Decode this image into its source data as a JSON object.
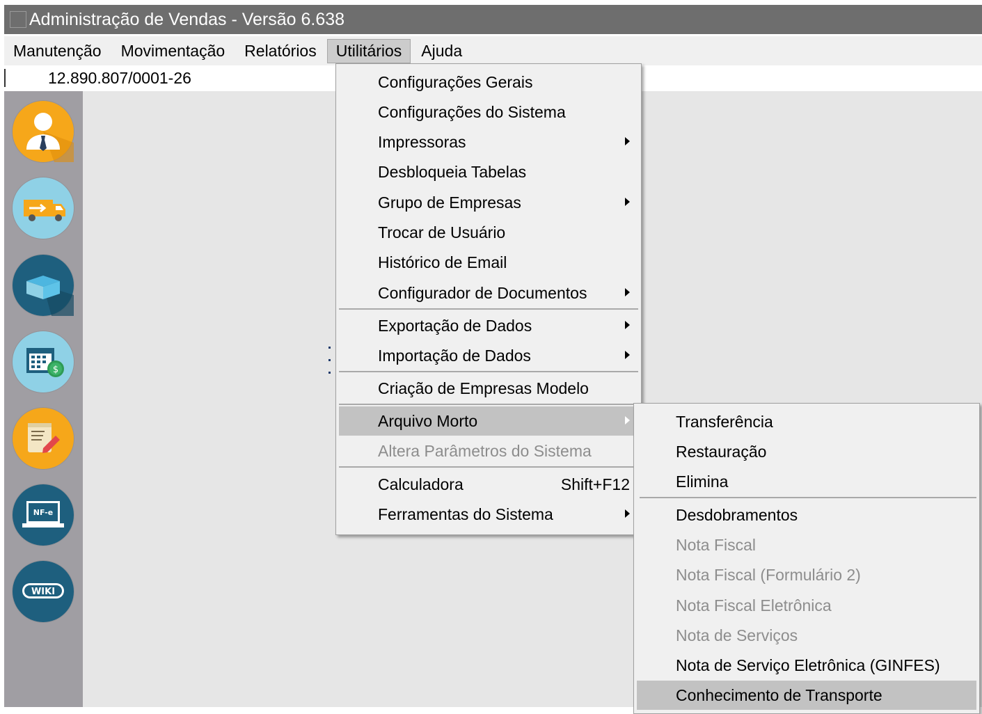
{
  "window": {
    "title": "Administração de Vendas - Versão 6.638"
  },
  "menubar": {
    "items": [
      {
        "label": "Manutenção"
      },
      {
        "label": "Movimentação"
      },
      {
        "label": "Relatórios"
      },
      {
        "label": "Utilitários",
        "active": true
      },
      {
        "label": "Ajuda"
      }
    ]
  },
  "company": {
    "cnpj": "12.890.807/0001-26"
  },
  "sidebar": {
    "buttons": [
      {
        "icon": "user-icon",
        "color": "#f6a71a"
      },
      {
        "icon": "delivery-truck-icon",
        "color": "#8fd1e6"
      },
      {
        "icon": "box-icon",
        "color": "#1e5f7e"
      },
      {
        "icon": "calendar-money-icon",
        "color": "#8fd1e6"
      },
      {
        "icon": "document-edit-icon",
        "color": "#f6a71a"
      },
      {
        "icon": "nfe-laptop-icon",
        "color": "#1e5f7e"
      },
      {
        "icon": "wiki-icon",
        "color": "#1e5f7e"
      }
    ],
    "nfe_label": "NF-e",
    "wiki_label": "WIKI"
  },
  "utilitarios_menu": {
    "items": [
      {
        "label": "Configurações Gerais"
      },
      {
        "label": "Configurações do Sistema"
      },
      {
        "label": "Impressoras",
        "submenu": true
      },
      {
        "label": "Desbloqueia Tabelas"
      },
      {
        "label": "Grupo de Empresas",
        "submenu": true
      },
      {
        "label": "Trocar de Usuário"
      },
      {
        "label": "Histórico de Email"
      },
      {
        "label": "Configurador de Documentos",
        "submenu": true
      },
      {
        "label": "Exportação de Dados",
        "submenu": true
      },
      {
        "label": "Importação de Dados",
        "submenu": true
      },
      {
        "label": "Criação de Empresas Modelo"
      },
      {
        "label": "Arquivo Morto",
        "submenu": true,
        "highlighted": true
      },
      {
        "label": "Altera Parâmetros do Sistema",
        "disabled": true
      },
      {
        "label": "Calculadora",
        "shortcut": "Shift+F12"
      },
      {
        "label": "Ferramentas do Sistema",
        "submenu": true
      }
    ]
  },
  "arquivo_morto_menu": {
    "items": [
      {
        "label": "Transferência"
      },
      {
        "label": "Restauração"
      },
      {
        "label": "Elimina"
      },
      {
        "label": "Desdobramentos"
      },
      {
        "label": "Nota Fiscal",
        "disabled": true
      },
      {
        "label": "Nota Fiscal (Formulário 2)",
        "disabled": true
      },
      {
        "label": "Nota Fiscal Eletrônica",
        "disabled": true
      },
      {
        "label": "Nota de Serviços",
        "disabled": true
      },
      {
        "label": "Nota de Serviço Eletrônica (GINFES)"
      },
      {
        "label": "Conhecimento de Transporte",
        "highlighted": true
      }
    ]
  }
}
